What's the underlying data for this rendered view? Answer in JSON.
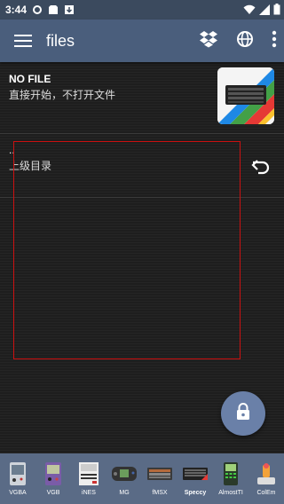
{
  "status_bar": {
    "time": "3:44"
  },
  "app_bar": {
    "title": "files",
    "icons": [
      "menu-icon",
      "dropbox-icon",
      "globe-icon",
      "more-vert-icon"
    ]
  },
  "current_file": {
    "name": "NO FILE",
    "description": "直接开始，不打开文件"
  },
  "file_list": [
    {
      "name": "..",
      "label": "上级目录"
    }
  ],
  "fab": {
    "icon": "lock-icon"
  },
  "bottom_tabs": [
    {
      "label": "VGBA",
      "icon": "gba-icon"
    },
    {
      "label": "VGB",
      "icon": "gameboy-icon"
    },
    {
      "label": "iNES",
      "icon": "nes-icon"
    },
    {
      "label": "MG",
      "icon": "gamegear-icon"
    },
    {
      "label": "fMSX",
      "icon": "msx-icon"
    },
    {
      "label": "Speccy",
      "icon": "spectrum-icon",
      "selected": true
    },
    {
      "label": "AlmostTI",
      "icon": "calculator-icon"
    },
    {
      "label": "ColEm",
      "icon": "colecovision-icon"
    }
  ]
}
